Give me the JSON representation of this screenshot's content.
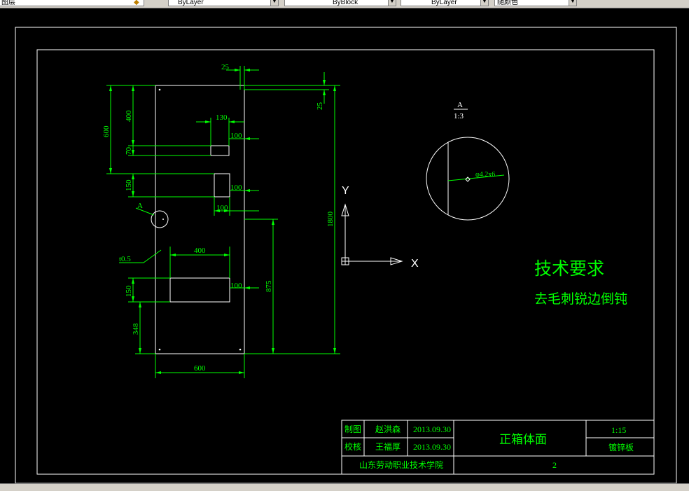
{
  "toolbar": {
    "left_label": "图层",
    "linetype_1": "ByLayer",
    "linetype_2": "ByBlock",
    "linetype_3": "ByLayer",
    "color_field": "随颜色"
  },
  "drawing": {
    "line_color": "#00ff00",
    "part_color": "#ffffff",
    "text_color": "#00ff00",
    "dimensions": {
      "d25_top": "25",
      "d25_right": "25",
      "d130": "130",
      "d100_a": "100",
      "d100_b": "100",
      "d100_c": "100",
      "d100_d": "100",
      "d400_top": "400",
      "d600_left": "600",
      "d70": "70",
      "d150_a": "150",
      "d150_b": "150",
      "d348": "348",
      "d400_h": "400",
      "d875": "875",
      "d1800": "1800",
      "d600_bottom": "600",
      "label_a": "A",
      "thickness": "t0.5"
    },
    "detail": {
      "label": "A",
      "scale": "1:3",
      "hole": "φ4.2x6"
    },
    "ucs": {
      "y": "Y",
      "x": "X"
    },
    "notes": {
      "title": "技术要求",
      "body": "去毛刺锐边倒钝"
    },
    "title_block": {
      "drawn_label": "制图",
      "drawn_name": "赵洪森",
      "drawn_date": "2013.09.30",
      "checked_label": "校核",
      "checked_name": "王福厚",
      "checked_date": "2013.09.30",
      "part_name": "正箱体面",
      "scale": "1:15",
      "material": "镀锌板",
      "school": "山东劳动职业技术学院",
      "sheet": "2"
    }
  }
}
